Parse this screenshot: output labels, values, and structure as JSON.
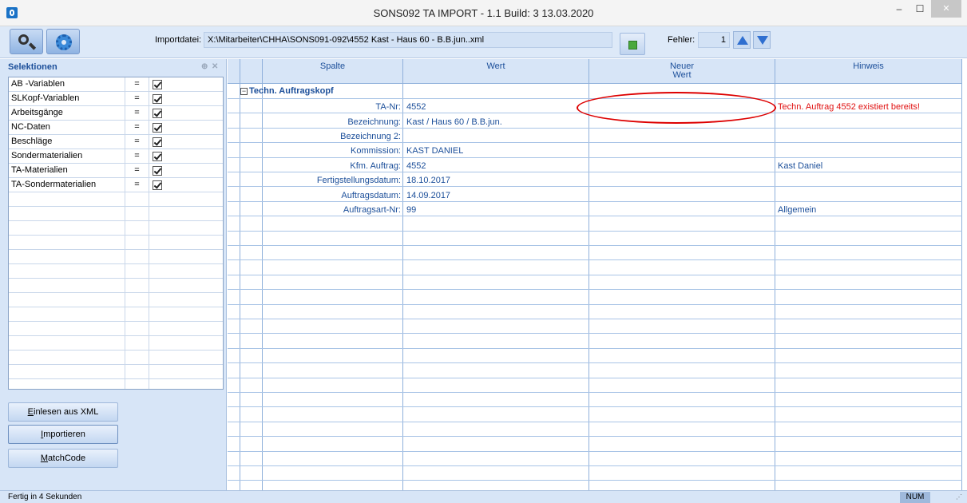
{
  "window": {
    "title": "SONS092 TA IMPORT - 1.1 Build: 3 13.03.2020",
    "minimize": "–",
    "maximize": "☐",
    "close": "✕"
  },
  "toolbar": {
    "import_label": "Importdatei:",
    "import_path": "X:\\Mitarbeiter\\CHHA\\SONS091-092\\4552 Kast - Haus 60 - B.B.jun..xml",
    "fehler_label": "Fehler:",
    "fehler_value": "1"
  },
  "selections": {
    "title": "Selektionen",
    "pin": "⊕",
    "close": "✕",
    "items": [
      {
        "name": "AB -Variablen",
        "op": "=",
        "checked": true
      },
      {
        "name": "SLKopf-Variablen",
        "op": "=",
        "checked": true
      },
      {
        "name": "Arbeitsgänge",
        "op": "=",
        "checked": true
      },
      {
        "name": "NC-Daten",
        "op": "=",
        "checked": true
      },
      {
        "name": "Beschläge",
        "op": "=",
        "checked": true
      },
      {
        "name": "Sondermaterialien",
        "op": "=",
        "checked": true
      },
      {
        "name": "TA-Materialien",
        "op": "=",
        "checked": true
      },
      {
        "name": "TA-Sondermaterialien",
        "op": "=",
        "checked": true
      }
    ]
  },
  "buttons": {
    "einlesen_prefix": "E",
    "einlesen_rest": "inlesen aus XML",
    "importieren_prefix": "I",
    "importieren_rest": "mportieren",
    "matchcode_prefix": "M",
    "matchcode_rest": "atchCode"
  },
  "grid": {
    "headers": {
      "spalte": "Spalte",
      "wert": "Wert",
      "neuer_wert_1": "Neuer",
      "neuer_wert_2": "Wert",
      "hinweis": "Hinweis"
    },
    "group": {
      "toggle": "−",
      "label": "Techn. Auftragskopf"
    },
    "rows": [
      {
        "label": "TA-Nr:",
        "value": "4552",
        "hint": "Techn. Auftrag 4552 existiert bereits!",
        "hint_error": true
      },
      {
        "label": "Bezeichnung:",
        "value": "Kast / Haus 60 / B.B.jun.",
        "hint": ""
      },
      {
        "label": "Bezeichnung 2:",
        "value": "",
        "hint": ""
      },
      {
        "label": "Kommission:",
        "value": "KAST DANIEL",
        "hint": ""
      },
      {
        "label": "Kfm. Auftrag:",
        "value": "4552",
        "hint": "Kast Daniel"
      },
      {
        "label": "Fertigstellungsdatum:",
        "value": "18.10.2017",
        "hint": ""
      },
      {
        "label": "Auftragsdatum:",
        "value": "14.09.2017",
        "hint": ""
      },
      {
        "label": "Auftragsart-Nr:",
        "value": "99",
        "hint": "Allgemein"
      }
    ]
  },
  "status": {
    "text": "Fertig in 4 Sekunden",
    "num": "NUM"
  },
  "colors": {
    "error": "#e01010",
    "header_text": "#1c4f9a",
    "panel_bg": "#d7e5f7",
    "annotation": "#dd0000"
  }
}
